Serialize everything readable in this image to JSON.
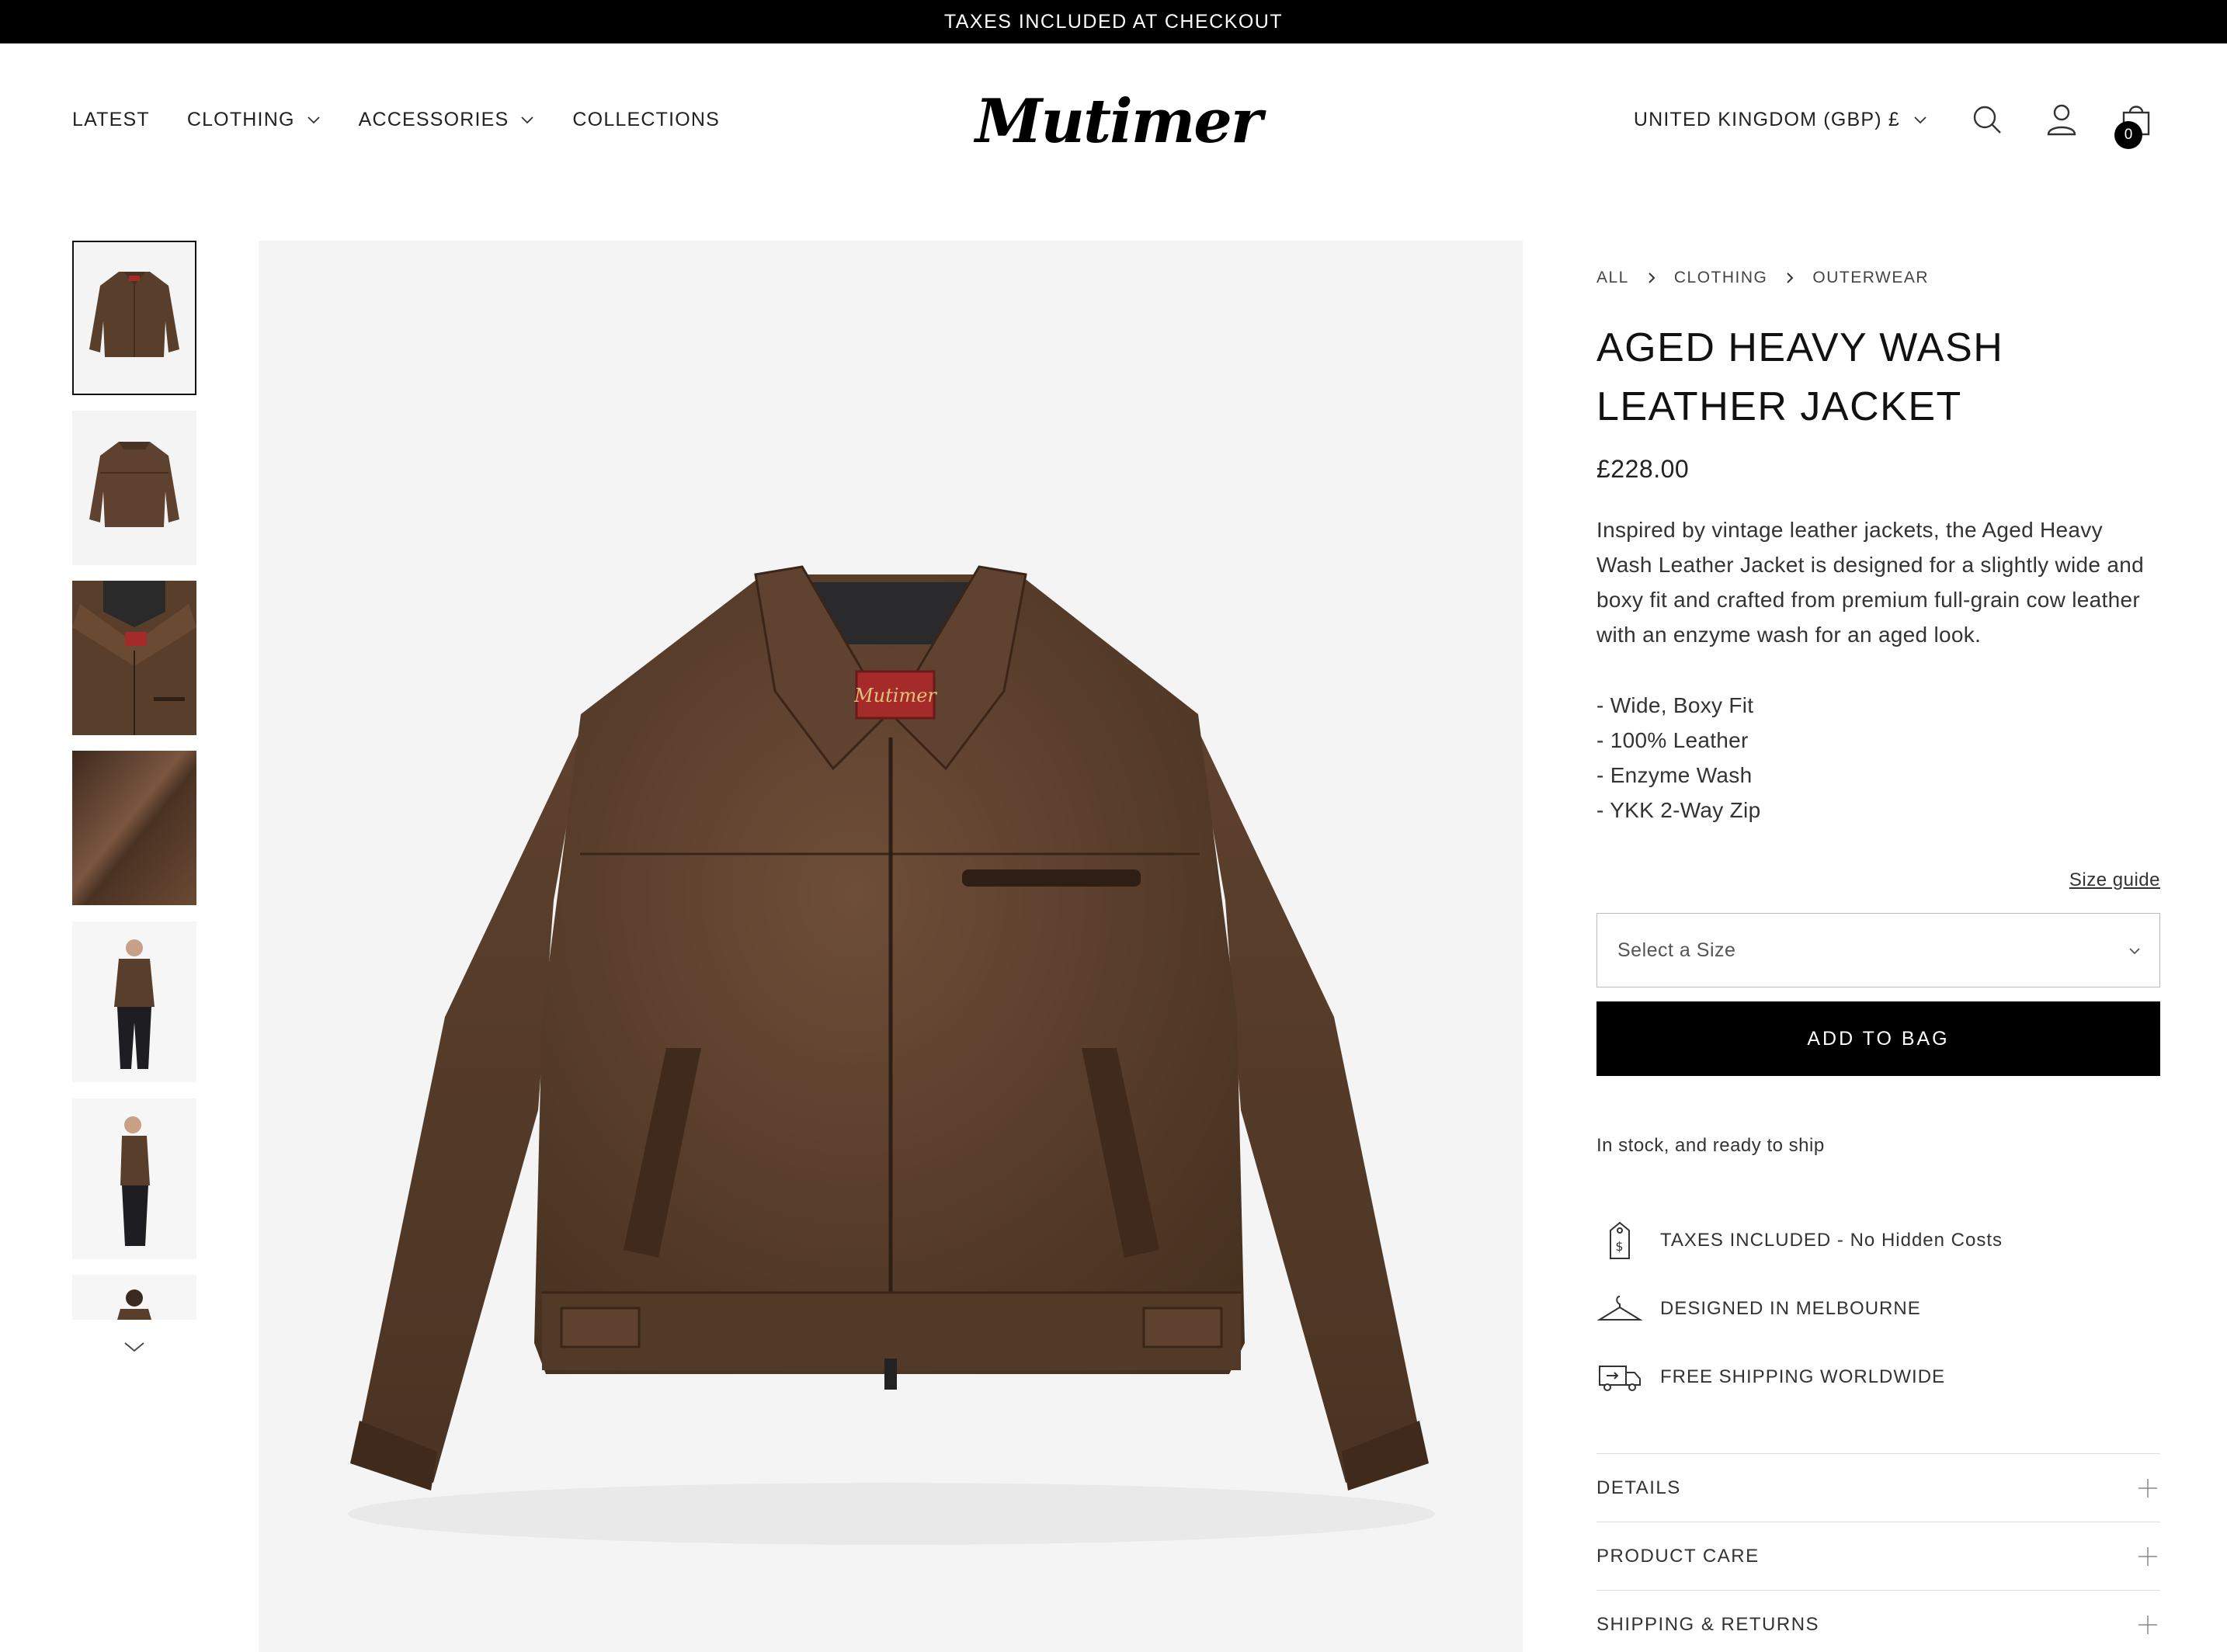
{
  "announcement": "TAXES INCLUDED AT CHECKOUT",
  "nav": {
    "latest": "LATEST",
    "clothing": "CLOTHING",
    "accessories": "ACCESSORIES",
    "collections": "COLLECTIONS"
  },
  "brand": {
    "logo_text": "Mutimer"
  },
  "utility": {
    "country": "UNITED KINGDOM (GBP) £",
    "cart_count": "0"
  },
  "thumbnails": [
    "front-flat",
    "back-flat",
    "collar-detail",
    "leather-texture",
    "model-front",
    "model-side",
    "model-back"
  ],
  "breadcrumb": {
    "all": "ALL",
    "clothing": "CLOTHING",
    "outerwear": "OUTERWEAR"
  },
  "product": {
    "title": "AGED HEAVY WASH LEATHER JACKET",
    "price": "£228.00",
    "description": "Inspired by vintage leather jackets, the Aged Heavy Wash Leather Jacket is designed for a slightly wide and boxy fit and crafted from premium full-grain cow leather with an enzyme wash for an aged look.",
    "bullets": [
      "- Wide, Boxy Fit",
      "- 100% Leather",
      "- Enzyme Wash",
      "- YKK 2-Way Zip"
    ],
    "size_guide": "Size guide",
    "size_placeholder": "Select a Size",
    "add_to_bag": "ADD TO BAG",
    "stock": "In stock, and ready to ship",
    "label_text": "Mutimer"
  },
  "features": [
    {
      "icon": "price-tag-icon",
      "label": "TAXES INCLUDED - No Hidden Costs"
    },
    {
      "icon": "hanger-icon",
      "label": "DESIGNED IN MELBOURNE"
    },
    {
      "icon": "delivery-truck-icon",
      "label": "FREE SHIPPING WORLDWIDE"
    }
  ],
  "accordions": [
    "DETAILS",
    "PRODUCT CARE",
    "SHIPPING & RETURNS"
  ],
  "colors": {
    "leather": "#5a3e2c",
    "background": "#f4f4f4",
    "accent": "#000000"
  }
}
